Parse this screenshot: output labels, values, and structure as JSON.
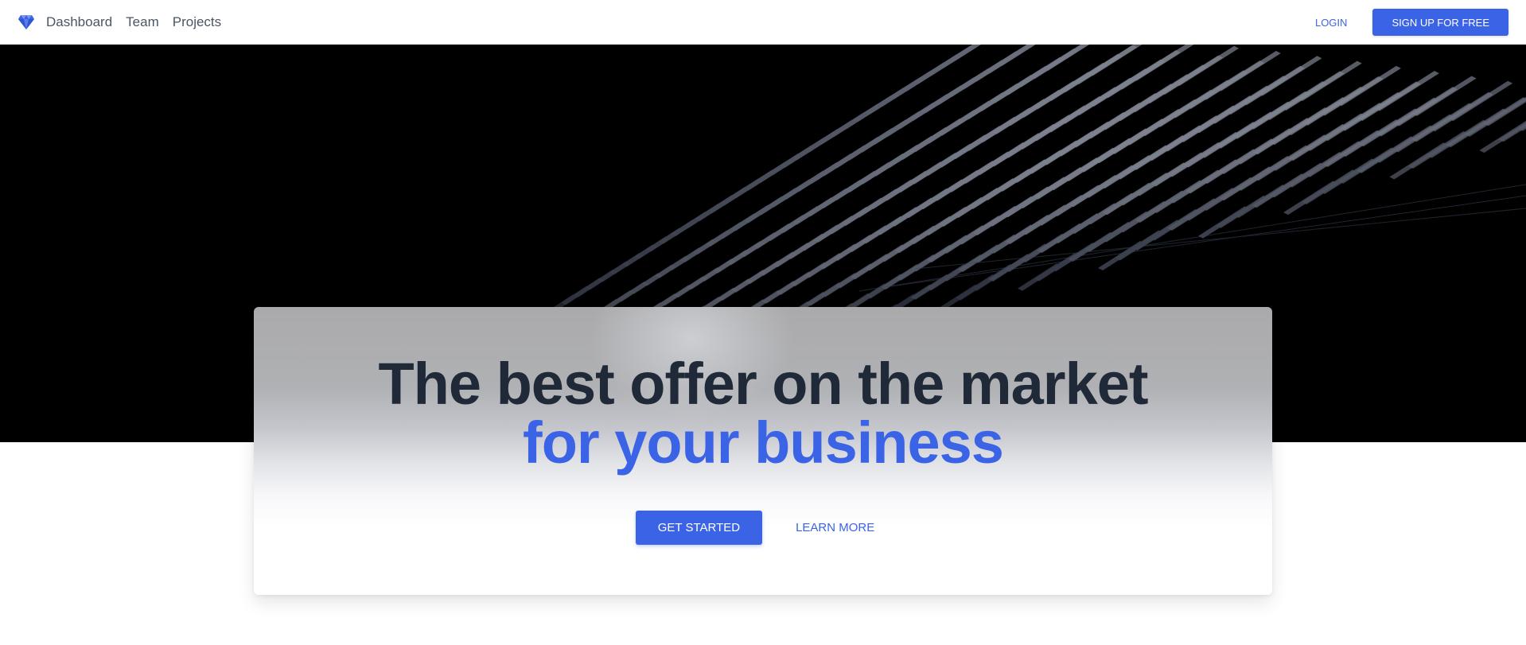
{
  "nav": {
    "logo_icon": "diamond-icon",
    "links": [
      "Dashboard",
      "Team",
      "Projects"
    ],
    "login_label": "LOGIN",
    "signup_label": "SIGN UP FOR FREE"
  },
  "hero": {
    "headline_line1": "The best offer on the market",
    "headline_line2": "for your business",
    "primary_cta": "GET STARTED",
    "secondary_cta": "LEARN MORE"
  },
  "colors": {
    "accent": "#3b63e6",
    "heading": "#1f2937",
    "nav_text": "#4b5563",
    "hero_bg": "#000000"
  }
}
